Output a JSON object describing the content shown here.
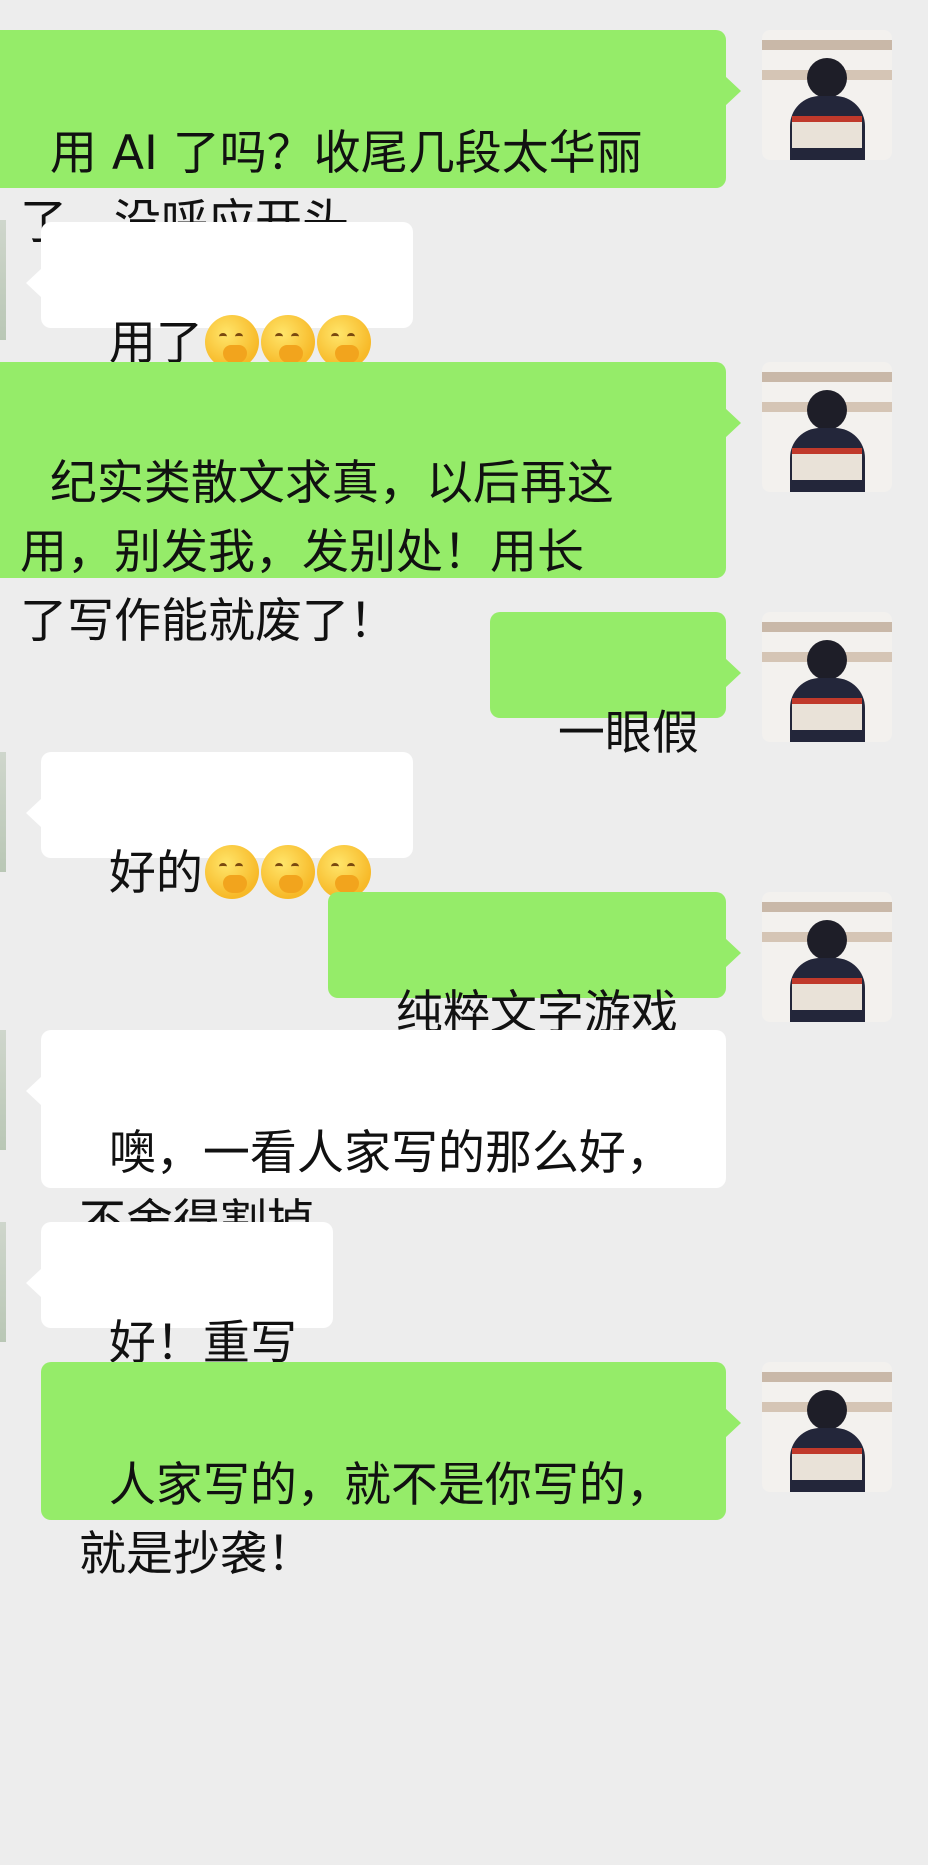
{
  "messages": [
    {
      "side": "out",
      "text": "用 AI 了吗？收尾几段太华丽\n了，没呼应开头"
    },
    {
      "side": "in",
      "text": "用了",
      "emoji": [
        "shy-face-icon",
        "shy-face-icon",
        "shy-face-icon"
      ]
    },
    {
      "side": "out",
      "text": "纪实类散文求真，以后再这\n用，别发我，发别处！用长\n了写作能就废了！"
    },
    {
      "side": "out",
      "text": "一眼假"
    },
    {
      "side": "in",
      "text": "好的",
      "emoji": [
        "shy-face-icon",
        "shy-face-icon",
        "shy-face-icon"
      ]
    },
    {
      "side": "out",
      "text": "纯粹文字游戏"
    },
    {
      "side": "in",
      "text": "噢，一看人家写的那么好，\n不舍得割掉"
    },
    {
      "side": "in",
      "text": "好！重写"
    },
    {
      "side": "out",
      "text": "人家写的，就不是你写的，\n就是抄袭！"
    }
  ],
  "colors": {
    "background": "#ededed",
    "outgoing": "#95ec69",
    "incoming": "#ffffff"
  }
}
